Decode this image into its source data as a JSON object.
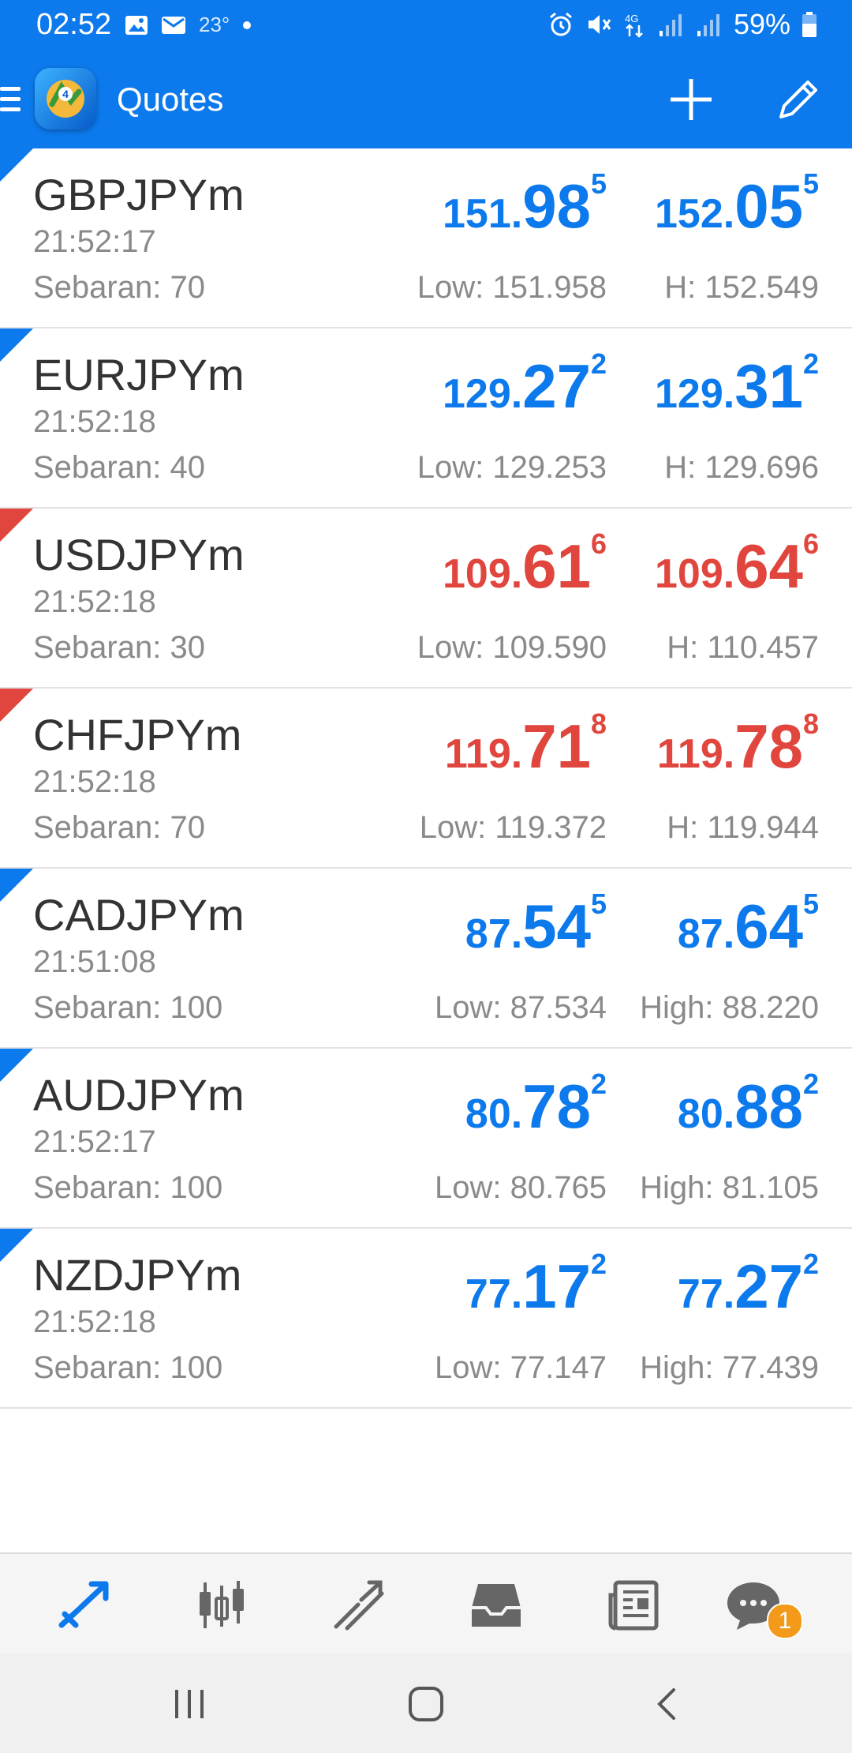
{
  "status_bar": {
    "time": "02:52",
    "temperature": "23°",
    "battery": "59%"
  },
  "app_bar": {
    "title": "Quotes"
  },
  "colors": {
    "primary": "#0c79ec",
    "up": "#0c79ec",
    "down": "#e0463d",
    "badge": "#f39a1a"
  },
  "quotes": [
    {
      "symbol": "GBPJPYm",
      "time": "21:52:17",
      "spread": "Sebaran: 70",
      "direction": "up",
      "bid": {
        "small": "151.",
        "big": "98",
        "sup": "5"
      },
      "ask": {
        "small": "152.",
        "big": "05",
        "sup": "5"
      },
      "low": "Low: 151.958",
      "high": "H: 152.549"
    },
    {
      "symbol": "EURJPYm",
      "time": "21:52:18",
      "spread": "Sebaran: 40",
      "direction": "up",
      "bid": {
        "small": "129.",
        "big": "27",
        "sup": "2"
      },
      "ask": {
        "small": "129.",
        "big": "31",
        "sup": "2"
      },
      "low": "Low: 129.253",
      "high": "H: 129.696"
    },
    {
      "symbol": "USDJPYm",
      "time": "21:52:18",
      "spread": "Sebaran: 30",
      "direction": "down",
      "bid": {
        "small": "109.",
        "big": "61",
        "sup": "6"
      },
      "ask": {
        "small": "109.",
        "big": "64",
        "sup": "6"
      },
      "low": "Low: 109.590",
      "high": "H: 110.457"
    },
    {
      "symbol": "CHFJPYm",
      "time": "21:52:18",
      "spread": "Sebaran: 70",
      "direction": "down",
      "bid": {
        "small": "119.",
        "big": "71",
        "sup": "8"
      },
      "ask": {
        "small": "119.",
        "big": "78",
        "sup": "8"
      },
      "low": "Low: 119.372",
      "high": "H: 119.944"
    },
    {
      "symbol": "CADJPYm",
      "time": "21:51:08",
      "spread": "Sebaran: 100",
      "direction": "up",
      "bid": {
        "small": "87.",
        "big": "54",
        "sup": "5"
      },
      "ask": {
        "small": "87.",
        "big": "64",
        "sup": "5"
      },
      "low": "Low: 87.534",
      "high": "High: 88.220"
    },
    {
      "symbol": "AUDJPYm",
      "time": "21:52:17",
      "spread": "Sebaran: 100",
      "direction": "up",
      "bid": {
        "small": "80.",
        "big": "78",
        "sup": "2"
      },
      "ask": {
        "small": "80.",
        "big": "88",
        "sup": "2"
      },
      "low": "Low: 80.765",
      "high": "High: 81.105"
    },
    {
      "symbol": "NZDJPYm",
      "time": "21:52:18",
      "spread": "Sebaran: 100",
      "direction": "up",
      "bid": {
        "small": "77.",
        "big": "17",
        "sup": "2"
      },
      "ask": {
        "small": "77.",
        "big": "27",
        "sup": "2"
      },
      "low": "Low: 77.147",
      "high": "High: 77.439"
    }
  ],
  "bottom_nav": {
    "items": [
      {
        "icon": "quotes-icon",
        "active": true
      },
      {
        "icon": "chart-icon",
        "active": false
      },
      {
        "icon": "trade-icon",
        "active": false
      },
      {
        "icon": "inbox-icon",
        "active": false
      },
      {
        "icon": "news-icon",
        "active": false
      },
      {
        "icon": "chat-icon",
        "active": false
      }
    ],
    "chat_badge": "1"
  }
}
